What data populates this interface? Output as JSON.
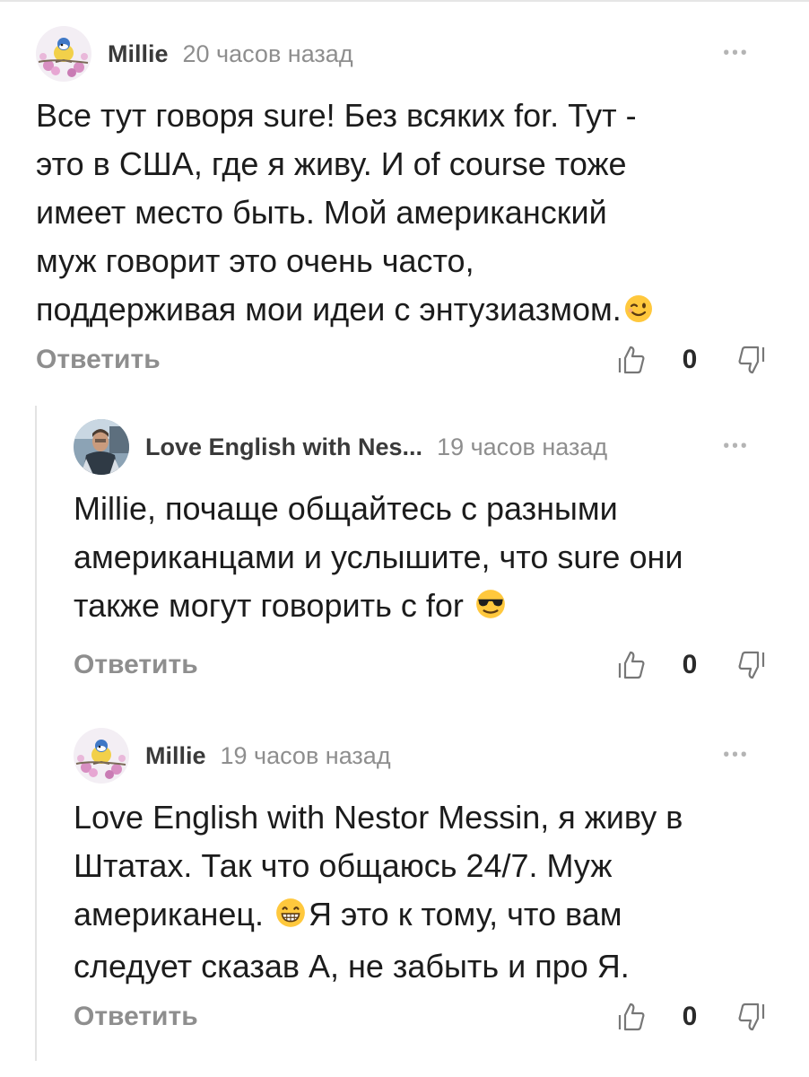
{
  "comments": [
    {
      "author": "Millie",
      "time": "20 часов назад",
      "text_before": "Все тут говоря sure! Без всяких for. Тут -\nэто в США, где я живу. И of course тоже\nимеет место быть. Мой американский\nмуж говорит это очень часто,\nподдерживая мои идеи с энтузиазмом.",
      "text_after": "",
      "emoji": "wink-emoji",
      "reply_label": "Ответить",
      "likes": "0",
      "avatar": "bird-avatar"
    },
    {
      "author": "Love English with Nes...",
      "time": "19 часов назад",
      "text_before": "Millie, почаще общайтесь с разными\nамериканцами и услышите, что sure они\nтакже могут говорить с for ",
      "text_after": "",
      "emoji": "sunglasses-emoji",
      "reply_label": "Ответить",
      "likes": "0",
      "avatar": "man-photo-avatar"
    },
    {
      "author": "Millie",
      "time": "19 часов назад",
      "text_before": "Love English with Nestor Messin, я живу в\nШтатах. Так что общаюсь 24/7. Муж\nамериканец. ",
      "text_after": "Я это к тому, что вам\nследует сказав А, не забыть и про Я.",
      "emoji": "grin-emoji",
      "reply_label": "Ответить",
      "likes": "0",
      "avatar": "bird-avatar"
    }
  ],
  "icons": {
    "more": "more-dots-icon",
    "like": "thumbs-up-icon",
    "dislike": "thumbs-down-icon"
  },
  "colors": {
    "text": "#1c1c1c",
    "muted": "#8e8e8e",
    "thread_line": "#e3e3e3"
  }
}
